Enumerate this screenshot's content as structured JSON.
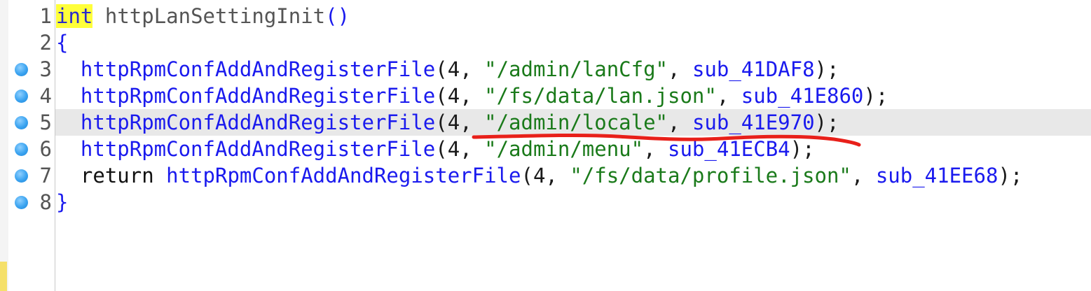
{
  "colors": {
    "identifier": "#1a1aee",
    "string": "#1a7a1a",
    "keyword_highlight": "#ffff3a",
    "line_highlight": "#e8e8e8",
    "breakpoint_dot": "#3aa3f0",
    "annotation_underline": "#e8201a"
  },
  "lines": [
    {
      "number": "1",
      "keyword": "int",
      "func_name": "httpLanSettingInit",
      "parens": "()"
    },
    {
      "number": "2",
      "text": "{"
    },
    {
      "number": "3",
      "indent": "  ",
      "call": "httpRpmConfAddAndRegisterFile",
      "open": "(",
      "arg_num": "4",
      "sep1": ", ",
      "path": "\"/admin/lanCfg\"",
      "sep2": ", ",
      "handler": "sub_41DAF8",
      "close": ");"
    },
    {
      "number": "4",
      "indent": "  ",
      "call": "httpRpmConfAddAndRegisterFile",
      "open": "(",
      "arg_num": "4",
      "sep1": ", ",
      "path": "\"/fs/data/lan.json\"",
      "sep2": ", ",
      "handler": "sub_41E860",
      "close": ");"
    },
    {
      "number": "5",
      "indent": "  ",
      "call": "httpRpmConfAddAndRegisterFile",
      "open": "(",
      "arg_num": "4",
      "sep1": ", ",
      "path": "\"/admin/locale\"",
      "sep2": ", ",
      "handler": "sub_41E970",
      "close": ");"
    },
    {
      "number": "6",
      "indent": "  ",
      "call": "httpRpmConfAddAndRegisterFile",
      "open": "(",
      "arg_num": "4",
      "sep1": ", ",
      "path": "\"/admin/menu\"",
      "sep2": ", ",
      "handler": "sub_41ECB4",
      "close": ");"
    },
    {
      "number": "7",
      "indent": "  ",
      "ret": "return ",
      "call": "httpRpmConfAddAndRegisterFile",
      "open": "(",
      "arg_num": "4",
      "sep1": ", ",
      "path": "\"/fs/data/profile.json\"",
      "sep2": ", ",
      "handler": "sub_41EE68",
      "close": ");"
    },
    {
      "number": "8",
      "text": "}"
    }
  ]
}
